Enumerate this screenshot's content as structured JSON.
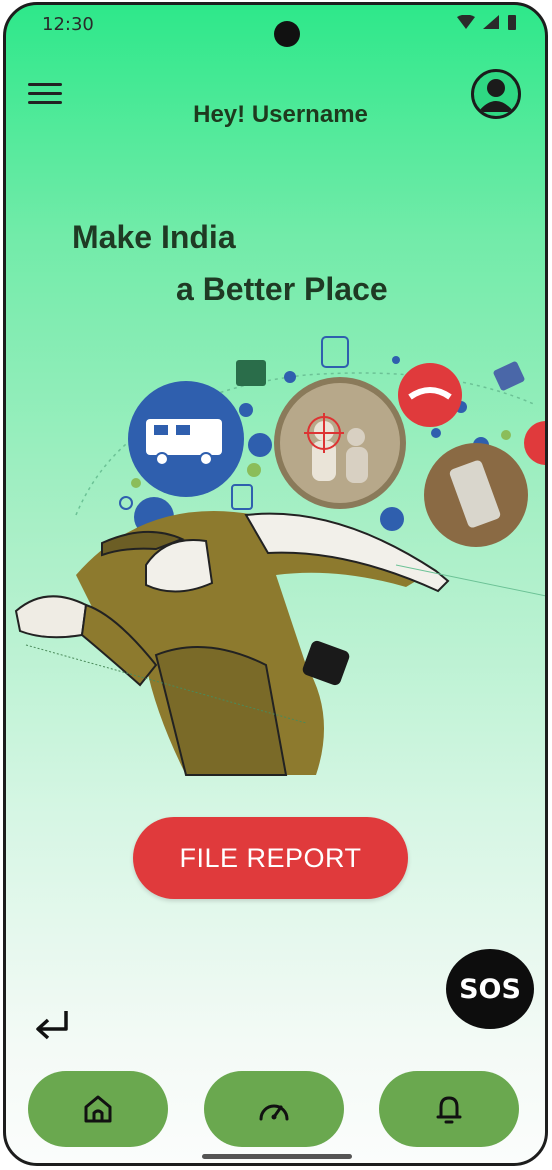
{
  "status_bar": {
    "time": "12:30"
  },
  "header": {
    "greeting": "Hey!  Username",
    "menu_icon": "hamburger-menu-icon",
    "profile_icon": "account-circle-icon"
  },
  "hero": {
    "tagline_line1": "Make India",
    "tagline_line2": "a Better Place"
  },
  "actions": {
    "file_report_label": "FILE REPORT",
    "sos_label": "SOS"
  },
  "bottom_nav": {
    "items": [
      {
        "icon": "home-icon"
      },
      {
        "icon": "speedometer-icon"
      },
      {
        "icon": "bell-icon"
      }
    ]
  },
  "colors": {
    "gradient_top": "#2ee88a",
    "gradient_bottom": "#fbfdfc",
    "file_report_bg": "#e03a3c",
    "nav_pill_bg": "#6aa84f",
    "sos_bg": "#0d0d0d"
  }
}
